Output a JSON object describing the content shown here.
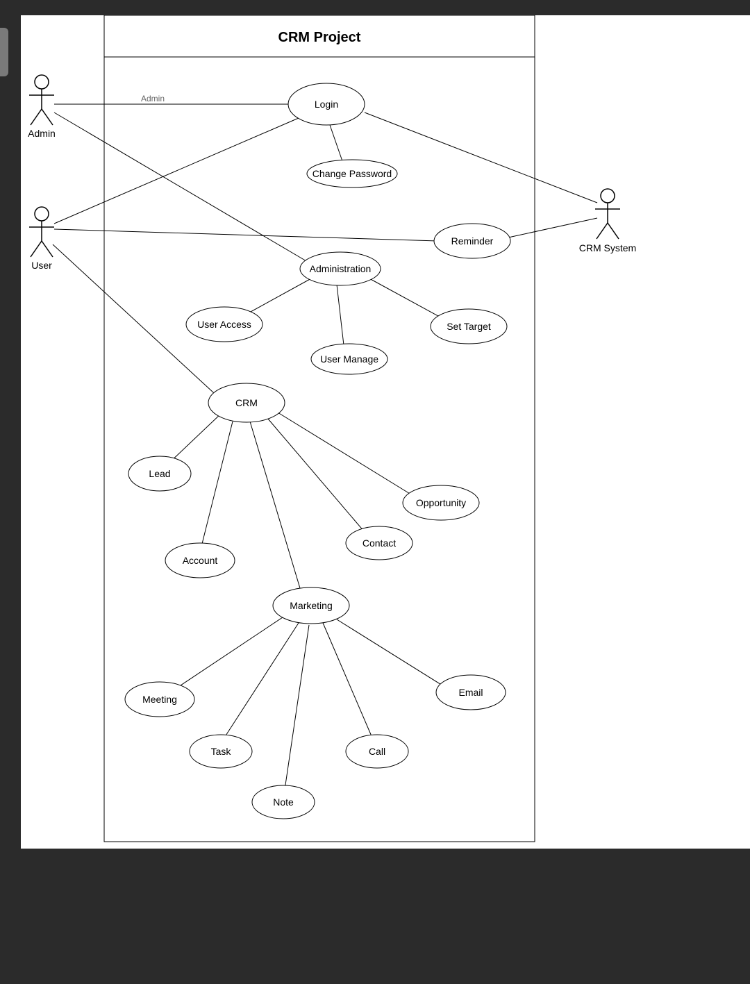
{
  "diagram": {
    "title": "CRM Project",
    "actors": {
      "admin": "Admin",
      "user": "User",
      "crm_system": "CRM System"
    },
    "edge_labels": {
      "admin_login": "Admin"
    },
    "usecases": {
      "login": "Login",
      "change_password": "Change Password",
      "reminder": "Reminder",
      "administration": "Administration",
      "user_access": "User Access",
      "user_manage": "User Manage",
      "set_target": "Set Target",
      "crm": "CRM",
      "lead": "Lead",
      "account": "Account",
      "contact": "Contact",
      "opportunity": "Opportunity",
      "marketing": "Marketing",
      "meeting": "Meeting",
      "task": "Task",
      "note": "Note",
      "call": "Call",
      "email": "Email"
    }
  }
}
